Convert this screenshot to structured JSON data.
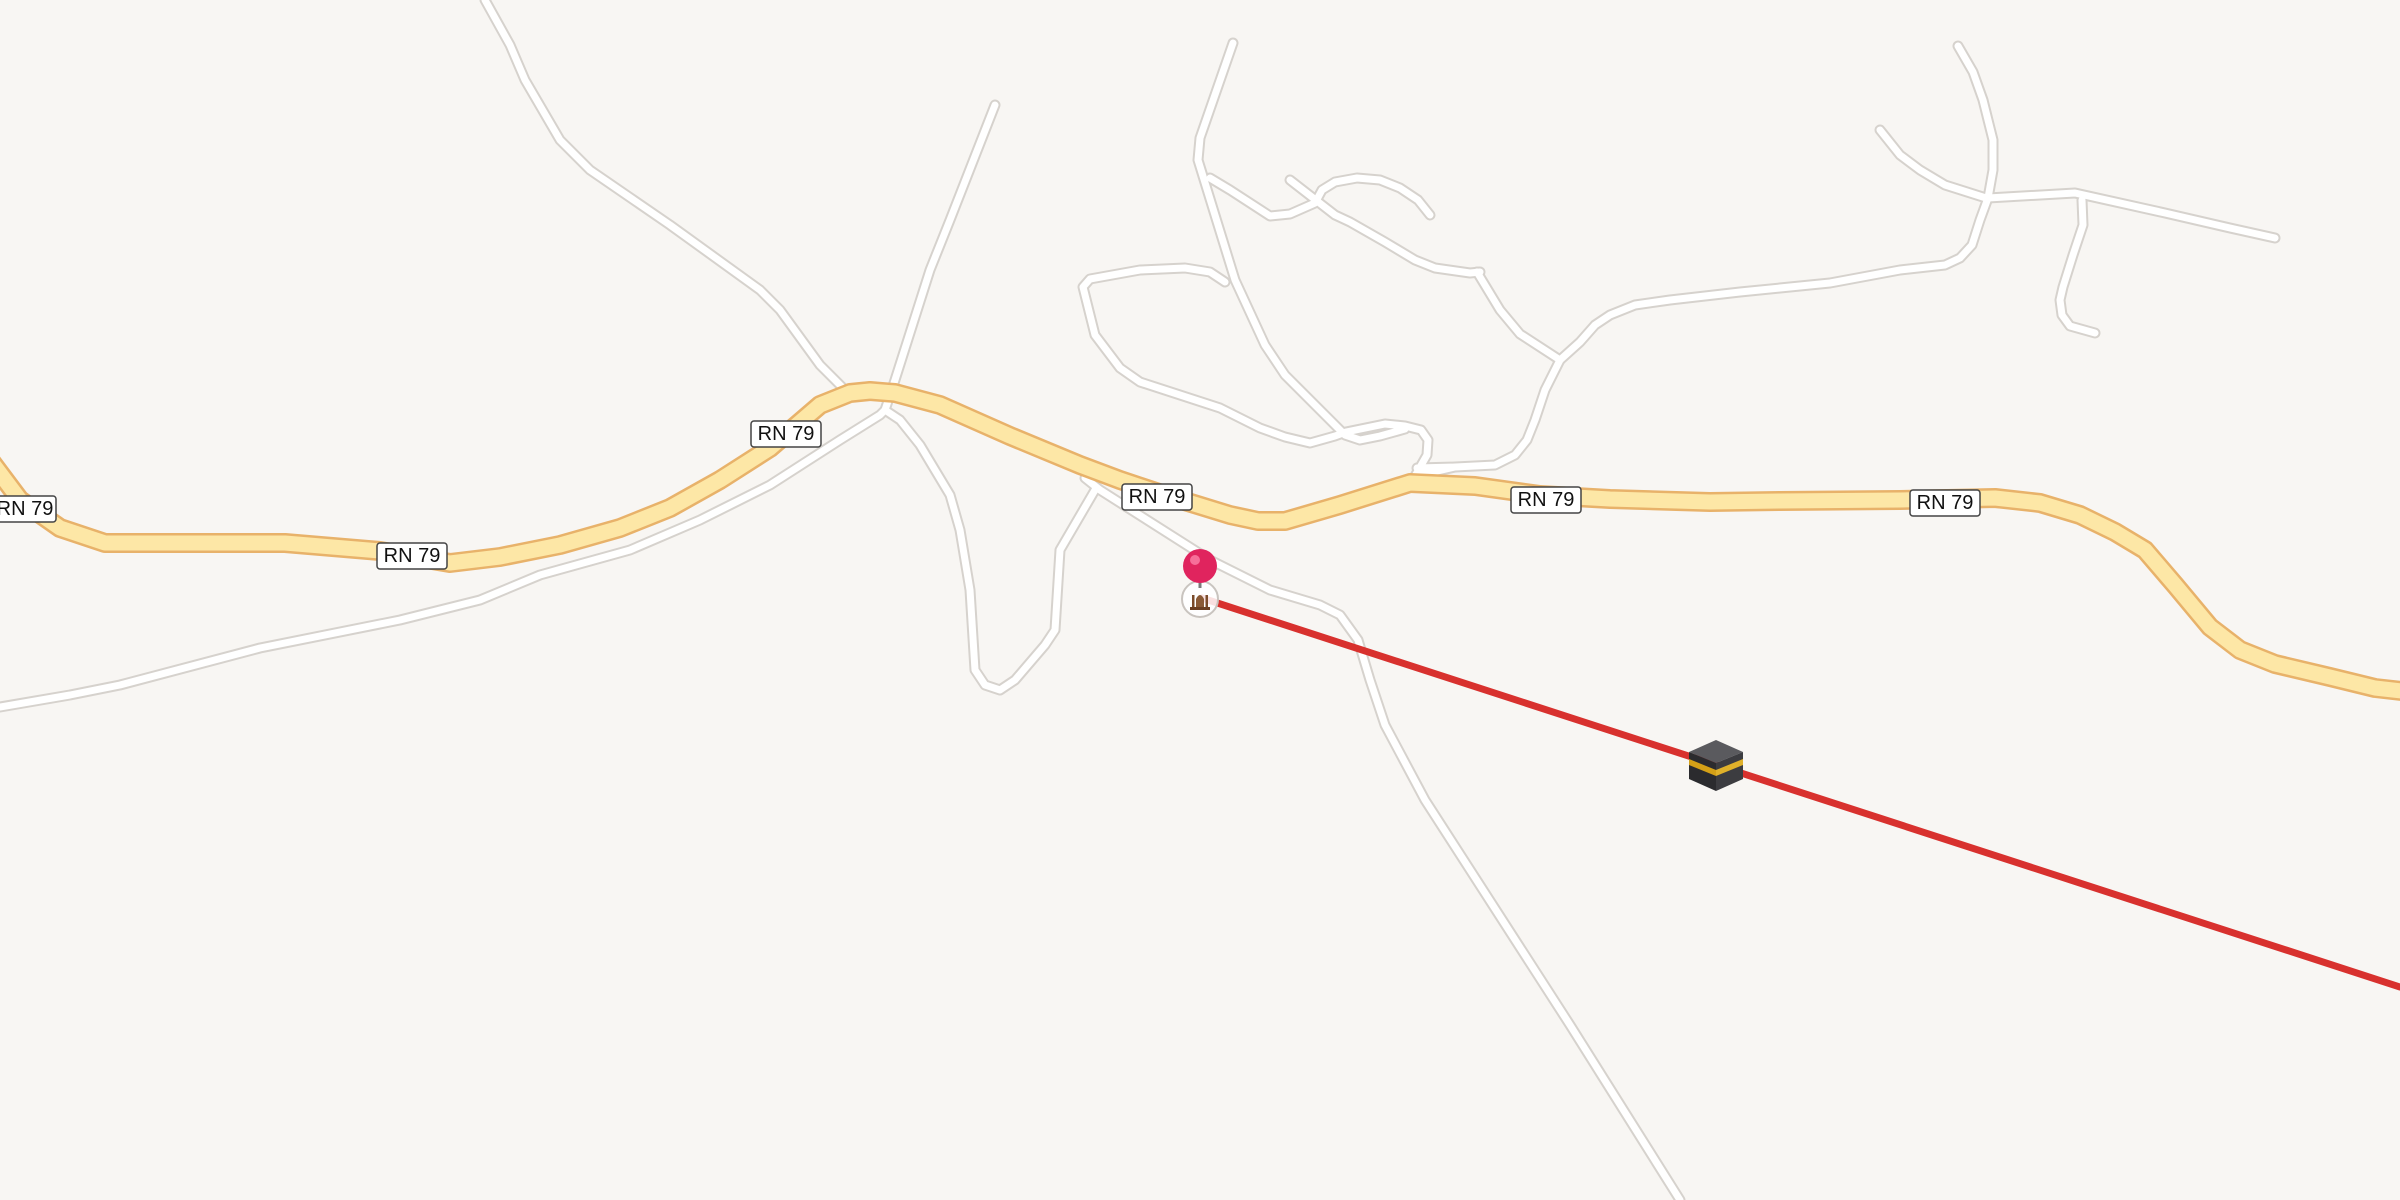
{
  "map": {
    "background": "#f8f6f3",
    "road_labels": [
      "RN 79",
      "RN 79",
      "RN 79",
      "RN 79",
      "RN 79",
      "RN 79"
    ],
    "colors": {
      "primary_road_fill": "#fde7a6",
      "primary_road_casing": "#e8b26a",
      "minor_road_fill": "#ffffff",
      "minor_road_casing": "#d9d6d2",
      "route_line": "#d8312e",
      "pin": "#e0245e"
    },
    "markers": {
      "location_pin": "map-pin-icon",
      "poi": "mosque-icon",
      "destination": "kaaba-icon"
    }
  }
}
